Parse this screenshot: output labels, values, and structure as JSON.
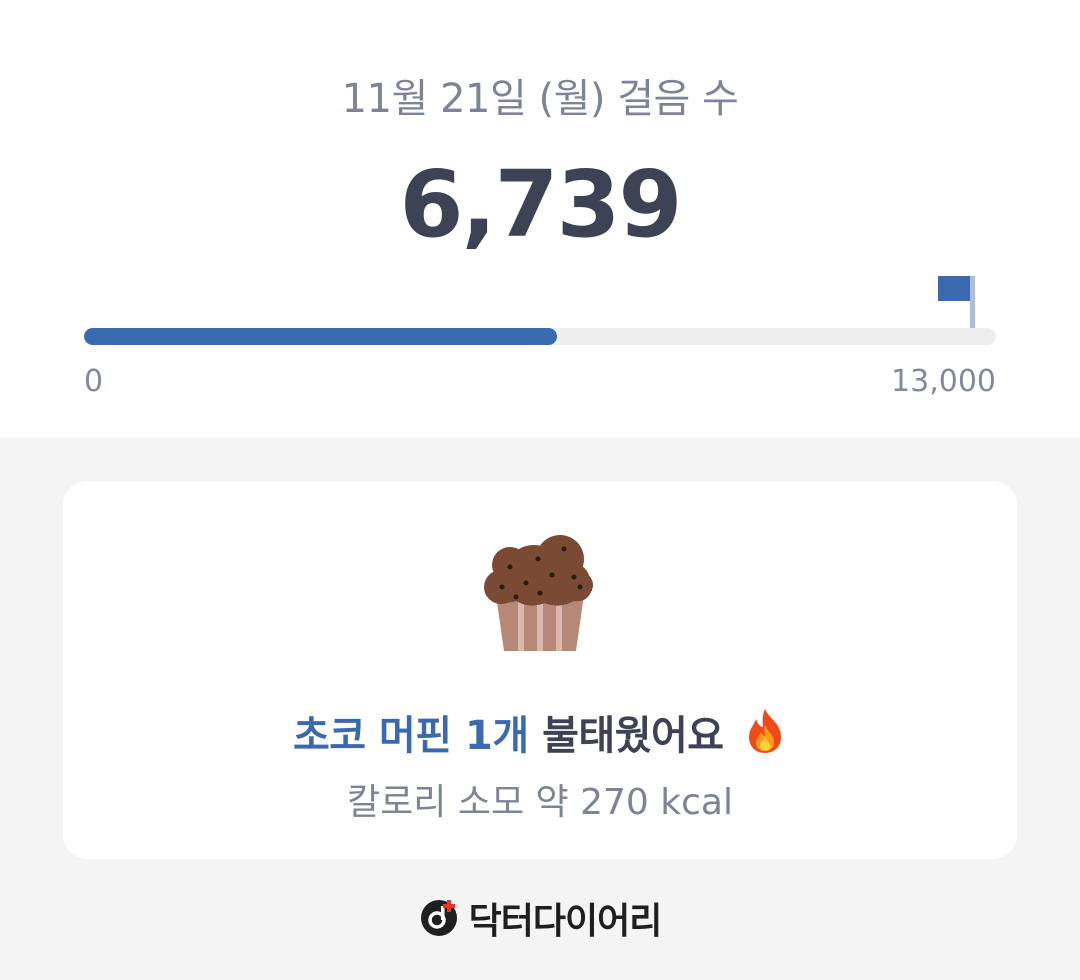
{
  "header": {
    "date_title": "11월 21일 (월) 걸음 수",
    "step_count": "6,739"
  },
  "progress": {
    "current_steps": 6739,
    "goal_steps": 13000,
    "axis_min_label": "0",
    "axis_max_label": "13,000",
    "fill_color": "#3a6aad",
    "flag_icon": "goal-flag-icon"
  },
  "burn_card": {
    "food_icon": "chocolate-muffin-icon",
    "food_label": "초코 머핀 1개",
    "burn_suffix": "불태웠어요",
    "burn_icon": "fire-icon",
    "calorie_text": "칼로리 소모 약 270 kcal",
    "accent_color": "#3a6aad"
  },
  "footer": {
    "brand_icon": "doctor-diary-logo-icon",
    "brand_name": "닥터다이어리"
  }
}
